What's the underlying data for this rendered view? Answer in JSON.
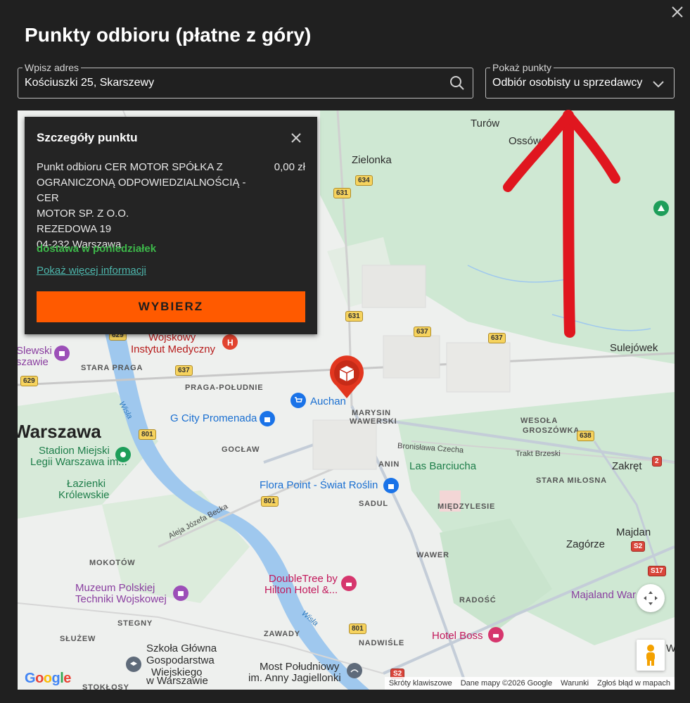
{
  "modal": {
    "title": "Punkty odbioru (płatne z góry)",
    "close_icon": "close-icon"
  },
  "address": {
    "legend": "Wpisz adres",
    "value": "Kościuszki 25, Skarszewy",
    "icon": "search-icon"
  },
  "points_filter": {
    "legend": "Pokaż punkty",
    "selected": "Odbiór osobisty u sprzedawcy",
    "icon": "chevron-down-icon"
  },
  "popup": {
    "title": "Szczegóły punktu",
    "lines": [
      "Punkt odbioru CER MOTOR SPÓŁKA Z",
      "OGRANICZONĄ ODPOWIEDZIALNOŚCIĄ - CER",
      "MOTOR SP. Z O.O.",
      "REZEDOWA 19",
      "04-232 Warszawa"
    ],
    "price": "0,00 zł",
    "delivery": "dostawa w poniedziałek",
    "more_link": "Pokaż więcej informacji",
    "select_button": "WYBIERZ"
  },
  "map": {
    "labels": {
      "turow": "Turów",
      "osso": "Ossów",
      "zielonka": "Zielonka",
      "sulejowek": "Sulejówek",
      "warszawa": "Warszawa",
      "stara_praga": "STARA PRAGA",
      "praga_poludnie": "PRAGA-POŁUDNIE",
      "goclaw": "GOCŁAW",
      "marysin": "MARYSIN",
      "wawerski": "WAWERSKI",
      "anin": "ANIN",
      "sadul": "SADUL",
      "miedzylesie": "MIĘDZYLESIE",
      "wesola": "WESOŁA",
      "groszowka": "GROSZÓWKA",
      "stara_milosna": "STARA MIŁOSNA",
      "zakret": "Zakręt",
      "majdan": "Majdan",
      "zagorze": "Zagórze",
      "wawer": "WAWER",
      "mokotow": "MOKOTÓW",
      "stegny": "STEGNY",
      "sluzew": "SŁUŻEW",
      "zawady": "ZAWADY",
      "nadwisle": "NADWIŚLE",
      "radosc": "RADOŚĆ",
      "stokłosy": "STOKŁOSY",
      "las_barciucha": "Las Barciucha",
      "wisla1": "Wisła",
      "wisla2": "Wisła",
      "bronislawa": "Bronisława Czecha",
      "trakt": "Trakt Brzeski",
      "becka": "Aleja Józefa Becka",
      "wojskowy1": "Wojskowy",
      "wojskowy2": "Instytut Medyczny",
      "slewski1": "Slewski",
      "slewski2": "szawie",
      "stadion1": "Stadion Miejski",
      "stadion2": "Legii Warszawa im...",
      "lazienki1": "Łazienki",
      "lazienki2": "Królewskie",
      "auchan": "Auchan",
      "gcity": "G City Promenada",
      "flora": "Flora Point - Świat Roślin",
      "muzeum1": "Muzeum Polskiej",
      "muzeum2": "Techniki Wojskowej",
      "doubletree1": "DoubleTree by",
      "doubletree2": "Hilton Hotel &...",
      "hotelboss": "Hotel Boss",
      "sggw1": "Szkoła Główna",
      "sggw2": "Gospodarstwa",
      "sggw3": "Wiejskiego",
      "sggw4": "w Warszawie",
      "most1": "Most Południowy",
      "most2": "im. Anny Jagiellonki",
      "majaland": "Majaland War",
      "wis": "Wis"
    },
    "shields": {
      "r631a": "631",
      "r634": "634",
      "r631b": "631",
      "r637a": "637",
      "r637b": "637",
      "r637c": "637",
      "r629a": "629",
      "r629b": "629",
      "r801a": "801",
      "r801b": "801",
      "r801c": "801",
      "r638": "638",
      "r2": "2",
      "s2a": "S2",
      "s2b": "S2",
      "s17": "S17"
    },
    "google": "Google",
    "attribution": {
      "shortcuts": "Skróty klawiszowe",
      "data": "Dane mapy ©2026 Google",
      "terms": "Warunki",
      "report": "Zgłoś błąd w mapach"
    }
  },
  "colors": {
    "accent": "#ff5a00",
    "delivery": "#3db84a",
    "link": "#4db6ac",
    "modal_bg": "#202020",
    "annotation": "#e0161f"
  }
}
